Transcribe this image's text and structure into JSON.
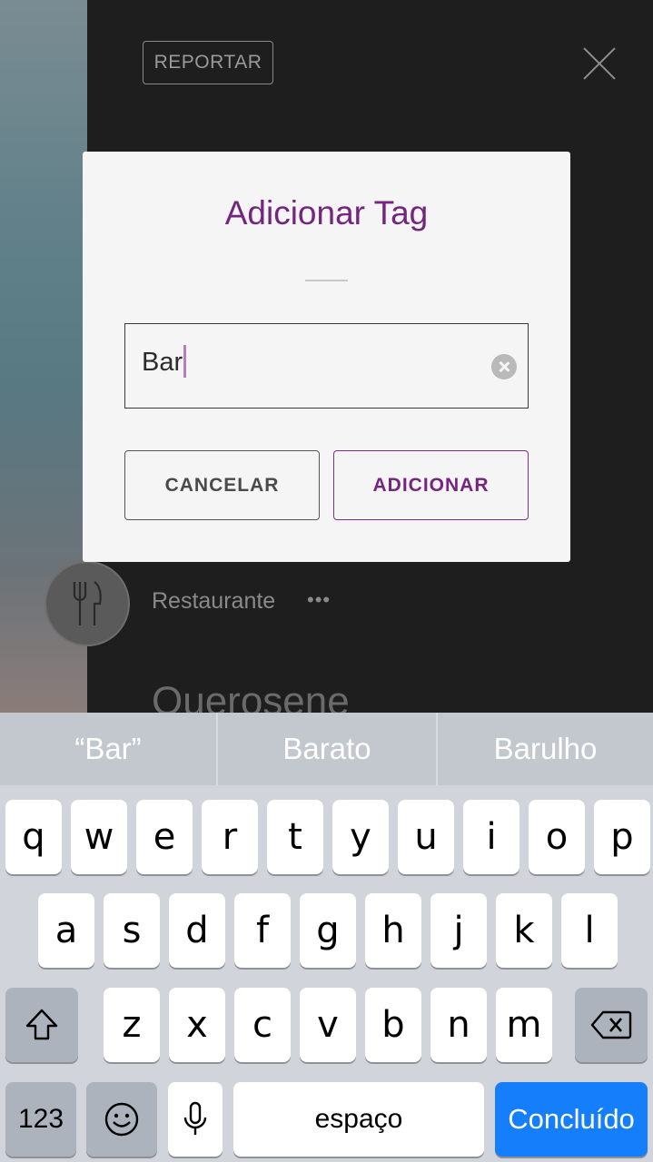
{
  "background": {
    "report_label": "REPORTAR",
    "category_label": "Restaurante",
    "category_more": "•••",
    "place_name": "Querosene"
  },
  "modal": {
    "title": "Adicionar Tag",
    "input_value": "Bar",
    "cancel_label": "CANCELAR",
    "add_label": "ADICIONAR"
  },
  "keyboard": {
    "suggestions": [
      "“Bar”",
      "Barato",
      "Barulho"
    ],
    "row1": [
      "q",
      "w",
      "e",
      "r",
      "t",
      "y",
      "u",
      "i",
      "o",
      "p"
    ],
    "row2": [
      "a",
      "s",
      "d",
      "f",
      "g",
      "h",
      "j",
      "k",
      "l"
    ],
    "row3": [
      "z",
      "x",
      "c",
      "v",
      "b",
      "n",
      "m"
    ],
    "numbers_label": "123",
    "space_label": "espaço",
    "done_label": "Concluído"
  },
  "colors": {
    "accent_purple": "#73257f",
    "keyboard_blue": "#157efb"
  }
}
